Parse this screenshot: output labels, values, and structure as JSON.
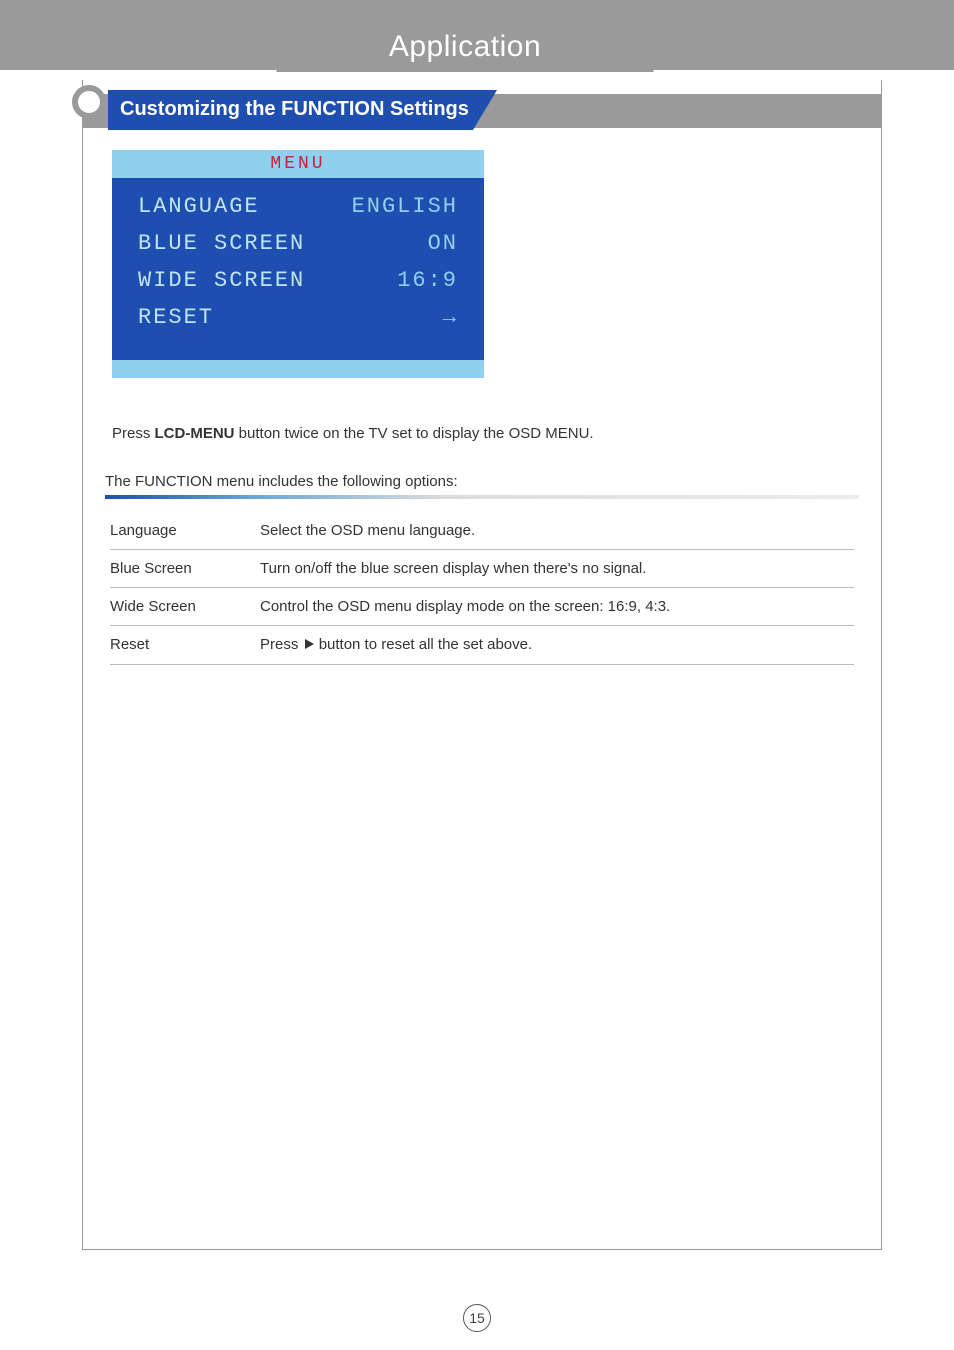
{
  "header": {
    "tab": "Application"
  },
  "section": {
    "title": "Customizing the FUNCTION Settings"
  },
  "osd": {
    "menu_label": "MENU",
    "rows": [
      {
        "label": "LANGUAGE",
        "value": "ENGLISH"
      },
      {
        "label": "BLUE SCREEN",
        "value": "ON"
      },
      {
        "label": "WIDE SCREEN",
        "value": "16:9"
      },
      {
        "label": "RESET",
        "value": "→"
      }
    ]
  },
  "instructions": {
    "line1_pre": "Press ",
    "line1_bold": "LCD-MENU",
    "line1_post": " button twice on the TV set to display the OSD MENU.",
    "line2": "The FUNCTION menu includes the following options:"
  },
  "options": [
    {
      "name": "Language",
      "desc": "Select the OSD menu language."
    },
    {
      "name": "Blue Screen",
      "desc": "Turn on/off the blue screen display when there's no signal."
    },
    {
      "name": "Wide Screen",
      "desc": "Control the OSD menu display mode on the screen: 16:9, 4:3."
    },
    {
      "name": "Reset",
      "desc_pre": "Press  ",
      "desc_post": " button to reset all the set above.",
      "has_icon": true
    }
  ],
  "page_number": "15"
}
